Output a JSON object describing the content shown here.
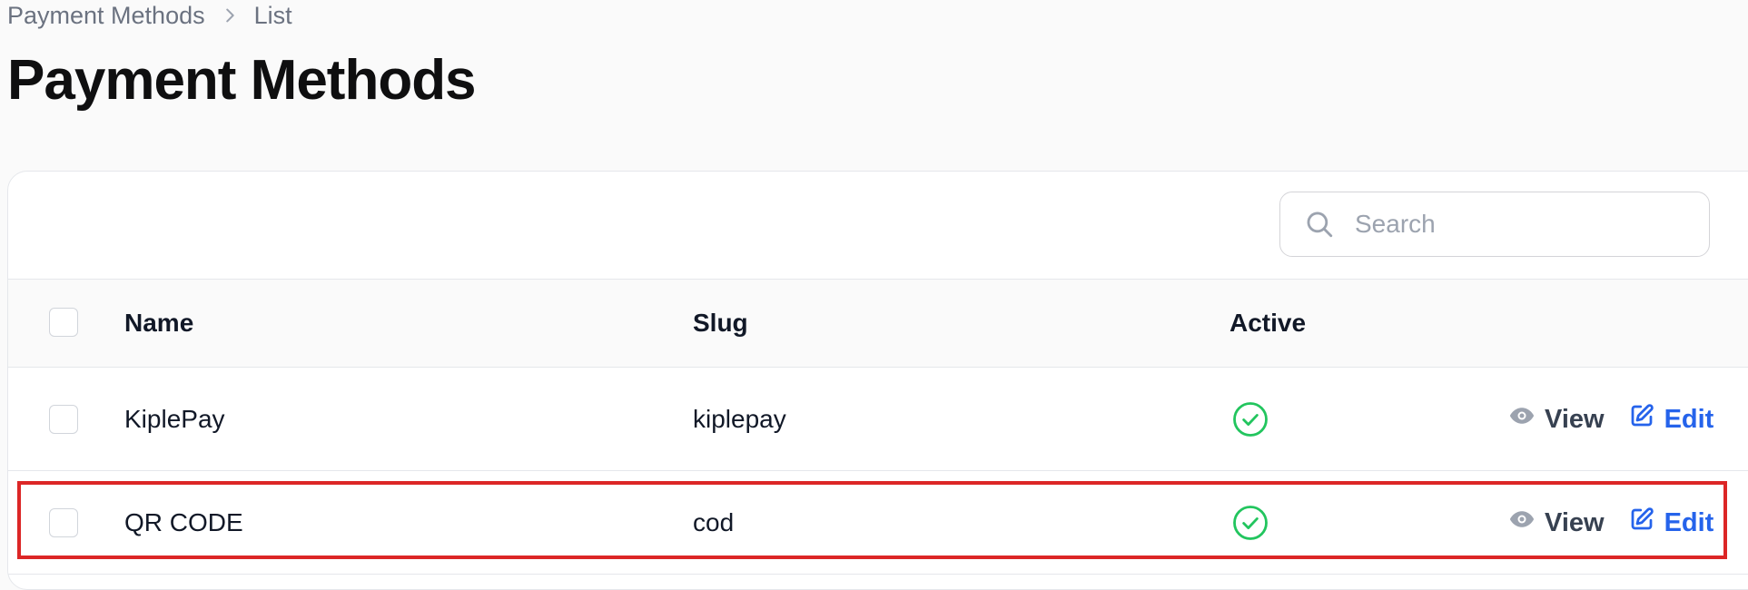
{
  "breadcrumb": {
    "items": [
      "Payment Methods",
      "List"
    ]
  },
  "page": {
    "title": "Payment Methods"
  },
  "search": {
    "placeholder": "Search"
  },
  "table": {
    "columns": [
      "Name",
      "Slug",
      "Active"
    ],
    "rows": [
      {
        "name": "KiplePay",
        "slug": "kiplepay",
        "active": true,
        "actions": [
          "View",
          "Edit"
        ]
      },
      {
        "name": "QR CODE",
        "slug": "cod",
        "active": true,
        "actions": [
          "View",
          "Edit"
        ]
      }
    ]
  },
  "colors": {
    "accent": "#2563eb",
    "success": "#22c55e",
    "highlight": "#dc2626"
  }
}
